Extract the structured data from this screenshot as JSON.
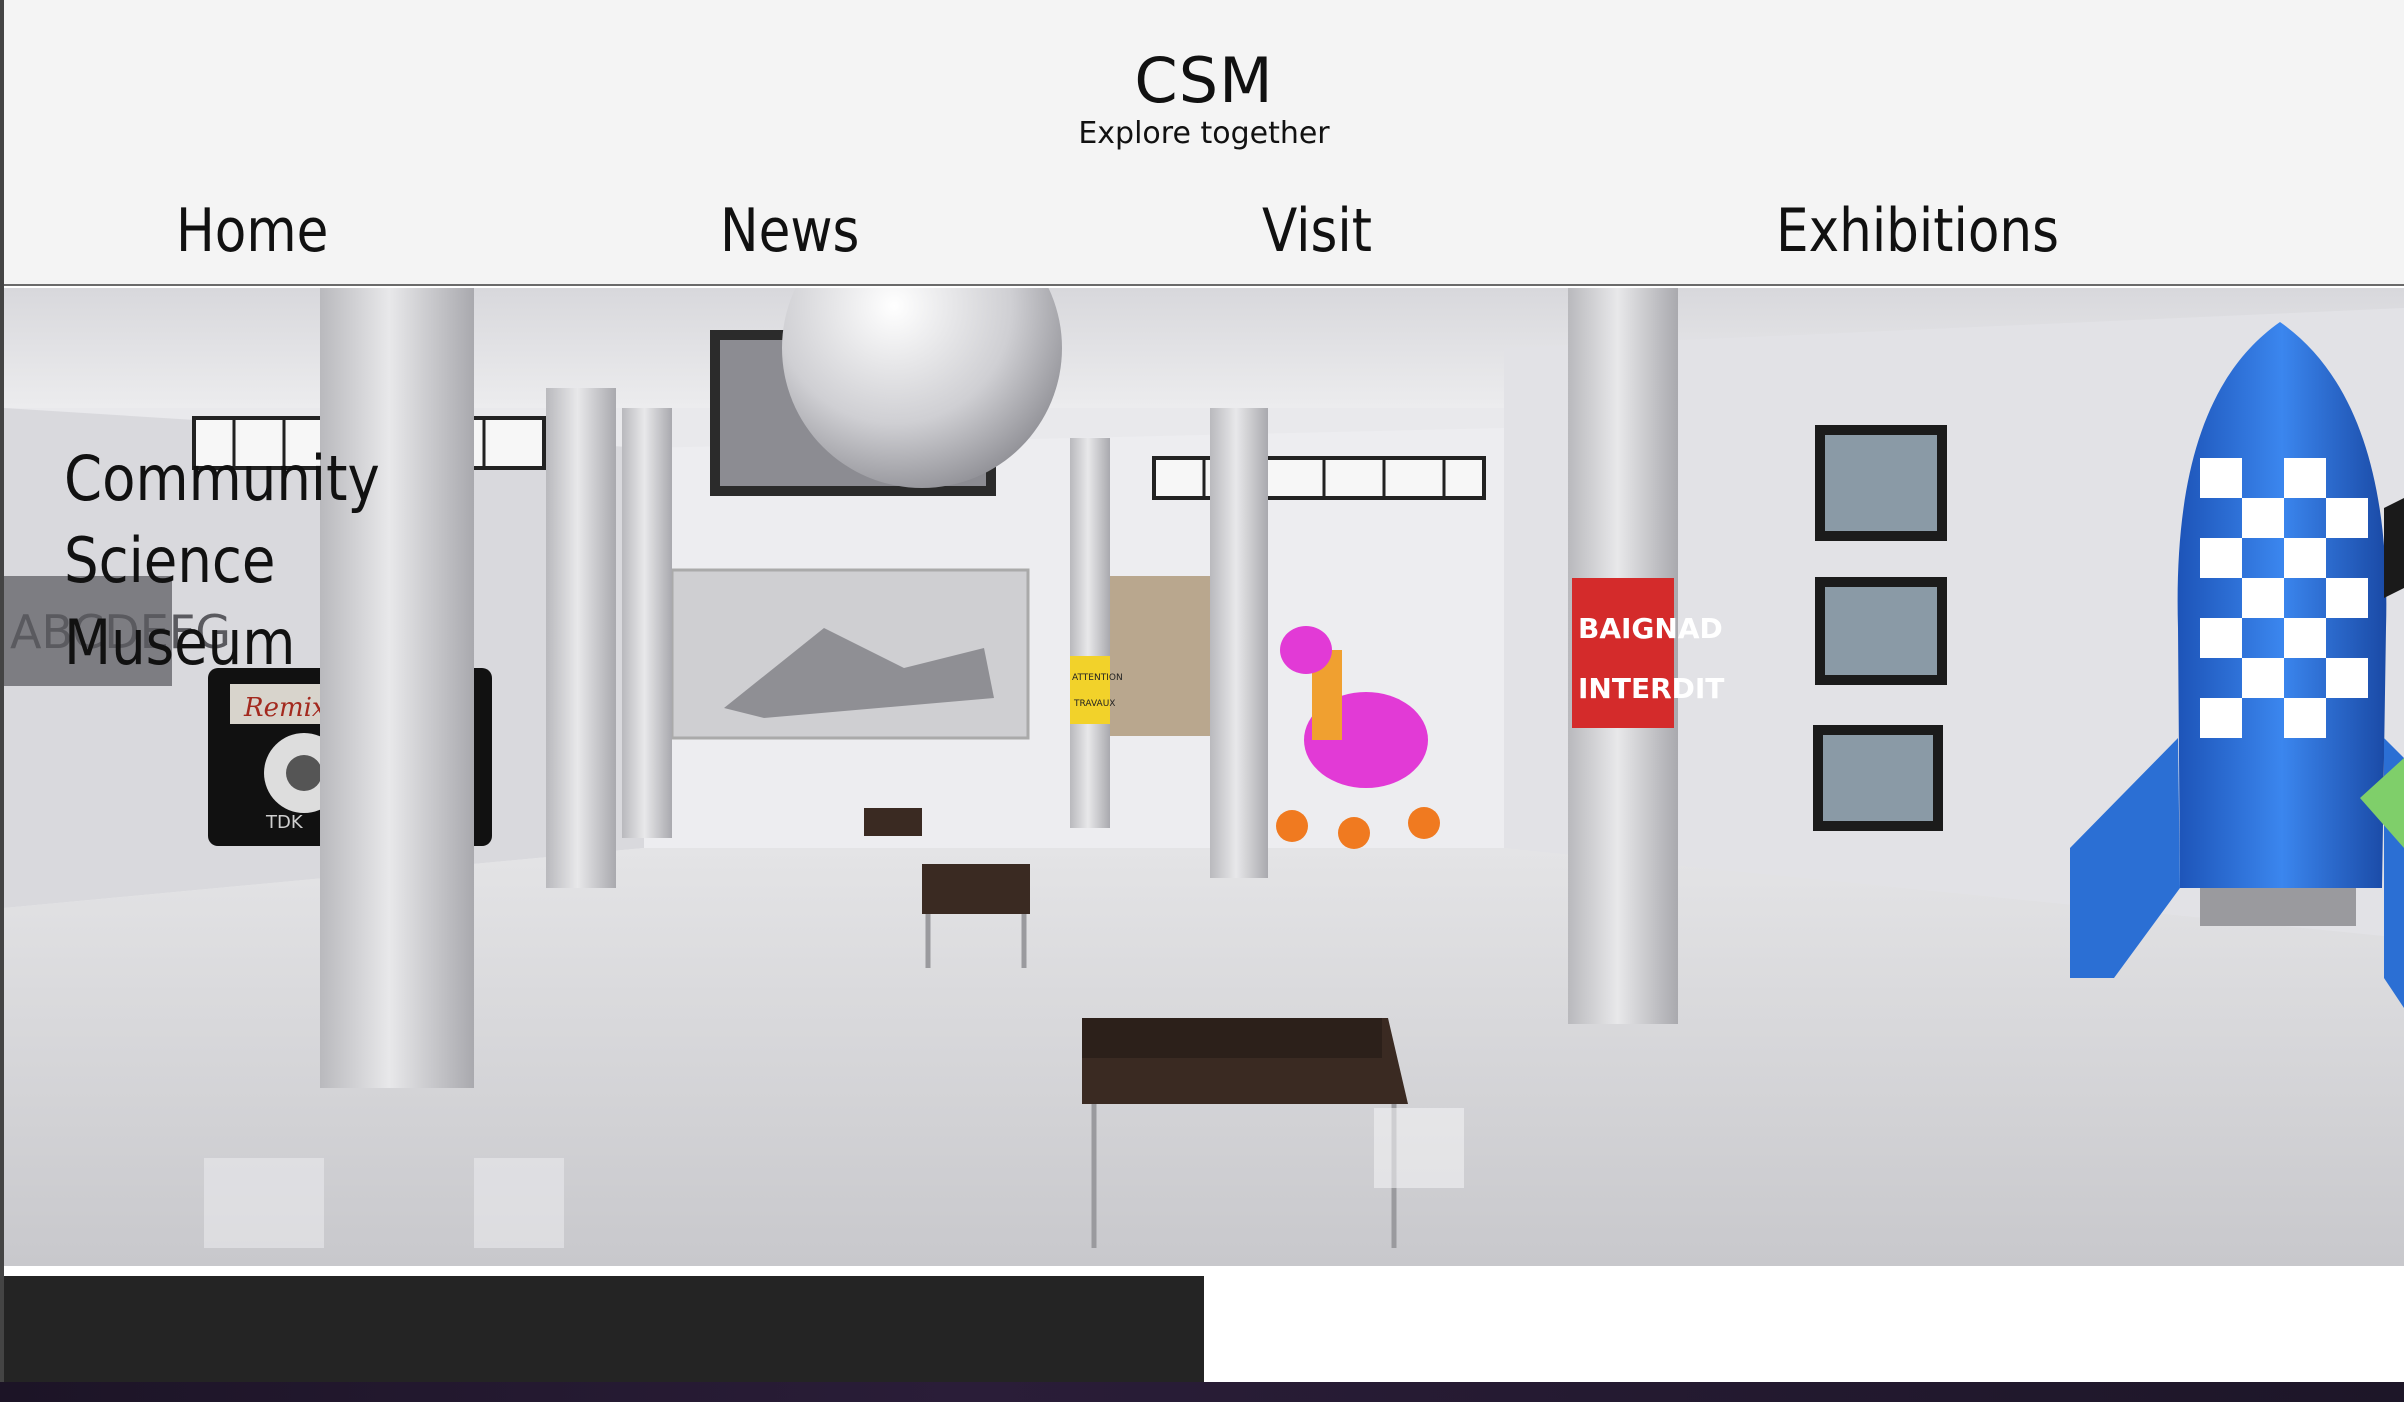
{
  "header": {
    "title": "CSM",
    "tagline": "Explore together"
  },
  "nav": {
    "items": [
      {
        "label": "Home"
      },
      {
        "label": "News"
      },
      {
        "label": "Visit"
      },
      {
        "label": "Exhibitions"
      }
    ]
  },
  "hero": {
    "caption_lines": [
      "Community",
      "Science",
      "Museum"
    ],
    "signs": {
      "cassette_label": "Remix",
      "cassette_brand": "TDK",
      "caution_line1": "ATTENTION",
      "caution_line2": "TRAVAUX",
      "pillar_sign_line1": "BAIGNAD",
      "pillar_sign_line2": "INTERDIT",
      "wall_letters": "ABCDEFG"
    }
  },
  "colors": {
    "header_bg": "#f4f4f4",
    "dark_panel": "#242424",
    "rocket_blue": "#2b6fd4",
    "giraffe_pink": "#e23ad6",
    "sign_red": "#d42b2b"
  }
}
